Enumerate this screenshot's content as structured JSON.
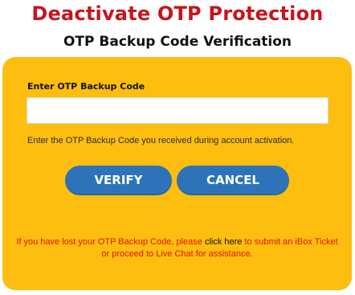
{
  "header": {
    "title": "Deactivate OTP Protection",
    "subtitle": "OTP Backup Code Verification"
  },
  "form": {
    "label": "Enter OTP Backup Code",
    "input_value": "",
    "helper_text": "Enter the OTP Backup Code you received during account activation."
  },
  "buttons": {
    "verify_label": "VERIFY",
    "cancel_label": "CANCEL"
  },
  "notice": {
    "prefix": "If you have lost your OTP Backup Code, please",
    "link_text": "click here",
    "line1_suffix": "to submit an iBox Ticket",
    "line2": "or proceed to Live Chat for assistance."
  },
  "colors": {
    "title": "#c8141c",
    "panel": "#fdbe0f",
    "button": "#2e73b9",
    "notice": "#e01212"
  }
}
